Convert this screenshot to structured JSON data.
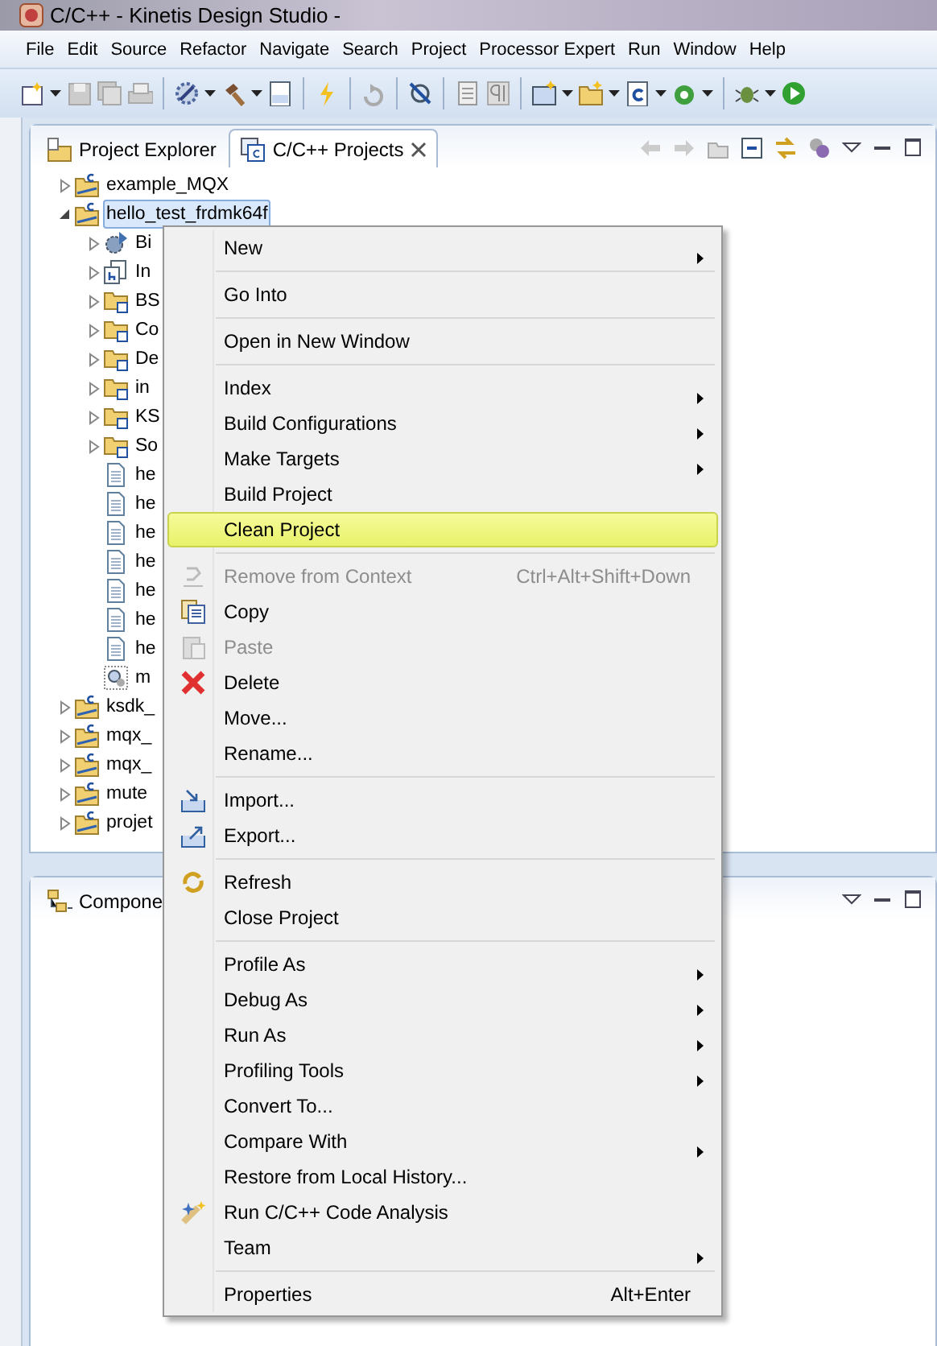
{
  "window": {
    "title": "C/C++ - Kinetis Design Studio -"
  },
  "menu_bar": [
    "File",
    "Edit",
    "Source",
    "Refactor",
    "Navigate",
    "Search",
    "Project",
    "Processor Expert",
    "Run",
    "Window",
    "Help"
  ],
  "project_panel": {
    "tabs": [
      {
        "label": "Project Explorer",
        "selected": false,
        "closable": false
      },
      {
        "label": "C/C++ Projects",
        "selected": true,
        "closable": true
      }
    ],
    "tree": [
      {
        "label": "example_MQX",
        "kind": "project",
        "expanded": false,
        "selected": false
      },
      {
        "label": "hello_test_frdmk64f",
        "kind": "project",
        "expanded": true,
        "selected": true,
        "children": [
          {
            "label": "Bi",
            "kind": "binaries",
            "expanded": false,
            "selected": false
          },
          {
            "label": "In",
            "kind": "includes",
            "expanded": false,
            "selected": false
          },
          {
            "label": "BS",
            "kind": "folder",
            "expanded": false,
            "selected": false
          },
          {
            "label": "Co",
            "kind": "folder",
            "expanded": false,
            "selected": false
          },
          {
            "label": "De",
            "kind": "folder",
            "expanded": false,
            "selected": false
          },
          {
            "label": "in",
            "kind": "folder",
            "expanded": false,
            "selected": false
          },
          {
            "label": "KS",
            "kind": "folder",
            "expanded": false,
            "selected": false
          },
          {
            "label": "So",
            "kind": "folder",
            "expanded": false,
            "selected": false
          },
          {
            "label": "he",
            "kind": "file",
            "selected": false
          },
          {
            "label": "he",
            "kind": "file",
            "selected": false
          },
          {
            "label": "he",
            "kind": "file",
            "selected": false
          },
          {
            "label": "he",
            "kind": "file",
            "selected": false
          },
          {
            "label": "he",
            "kind": "file",
            "selected": false
          },
          {
            "label": "he",
            "kind": "file",
            "selected": false
          },
          {
            "label": "he",
            "kind": "file",
            "selected": false
          },
          {
            "label": "m",
            "kind": "config",
            "selected": false
          }
        ]
      },
      {
        "label": "ksdk_",
        "kind": "project",
        "expanded": false,
        "selected": false
      },
      {
        "label": "mqx_",
        "kind": "project",
        "expanded": false,
        "selected": false
      },
      {
        "label": "mqx_",
        "kind": "project",
        "expanded": false,
        "selected": false
      },
      {
        "label": "mute",
        "kind": "project",
        "expanded": false,
        "selected": false
      },
      {
        "label": "projet",
        "kind": "project",
        "expanded": false,
        "selected": false
      }
    ]
  },
  "components_panel": {
    "tab": "Compone"
  },
  "context_menu": {
    "groups": [
      [
        {
          "label": "New",
          "submenu": true,
          "disabled": false,
          "selected": false
        }
      ],
      [
        {
          "label": "Go Into",
          "submenu": false,
          "disabled": false,
          "selected": false
        }
      ],
      [
        {
          "label": "Open in New Window",
          "submenu": false,
          "disabled": false,
          "selected": false
        }
      ],
      [
        {
          "label": "Index",
          "submenu": true,
          "disabled": false,
          "selected": false
        },
        {
          "label": "Build Configurations",
          "submenu": true,
          "disabled": false,
          "selected": false
        },
        {
          "label": "Make Targets",
          "submenu": true,
          "disabled": false,
          "selected": false
        },
        {
          "label": "Build Project",
          "submenu": false,
          "disabled": false,
          "selected": false
        },
        {
          "label": "Clean Project",
          "submenu": false,
          "disabled": false,
          "selected": true
        }
      ],
      [
        {
          "label": "Remove from Context",
          "shortcut": "Ctrl+Alt+Shift+Down",
          "submenu": false,
          "disabled": true,
          "selected": false
        },
        {
          "label": "Copy",
          "submenu": false,
          "disabled": false,
          "selected": false
        },
        {
          "label": "Paste",
          "submenu": false,
          "disabled": true,
          "selected": false
        },
        {
          "label": "Delete",
          "submenu": false,
          "disabled": false,
          "selected": false
        },
        {
          "label": "Move...",
          "submenu": false,
          "disabled": false,
          "selected": false
        },
        {
          "label": "Rename...",
          "submenu": false,
          "disabled": false,
          "selected": false
        }
      ],
      [
        {
          "label": "Import...",
          "submenu": false,
          "disabled": false,
          "selected": false
        },
        {
          "label": "Export...",
          "submenu": false,
          "disabled": false,
          "selected": false
        }
      ],
      [
        {
          "label": "Refresh",
          "submenu": false,
          "disabled": false,
          "selected": false
        },
        {
          "label": "Close Project",
          "submenu": false,
          "disabled": false,
          "selected": false
        }
      ],
      [
        {
          "label": "Profile As",
          "submenu": true,
          "disabled": false,
          "selected": false
        },
        {
          "label": "Debug As",
          "submenu": true,
          "disabled": false,
          "selected": false
        },
        {
          "label": "Run As",
          "submenu": true,
          "disabled": false,
          "selected": false
        },
        {
          "label": "Profiling Tools",
          "submenu": true,
          "disabled": false,
          "selected": false
        },
        {
          "label": "Convert To...",
          "submenu": false,
          "disabled": false,
          "selected": false
        },
        {
          "label": "Compare With",
          "submenu": true,
          "disabled": false,
          "selected": false
        },
        {
          "label": "Restore from Local History...",
          "submenu": false,
          "disabled": false,
          "selected": false
        },
        {
          "label": "Run C/C++ Code Analysis",
          "submenu": false,
          "disabled": false,
          "selected": false
        },
        {
          "label": "Team",
          "submenu": true,
          "disabled": false,
          "selected": false
        }
      ],
      [
        {
          "label": "Properties",
          "shortcut": "Alt+Enter",
          "submenu": false,
          "disabled": false,
          "selected": false
        }
      ]
    ]
  }
}
